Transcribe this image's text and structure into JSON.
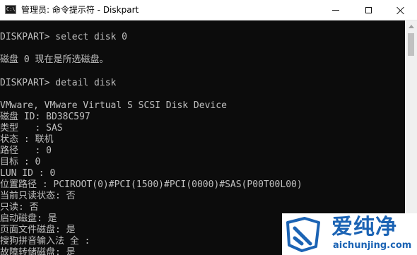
{
  "window": {
    "title": "管理员: 命令提示符 - Diskpart",
    "app_icon_text": "C:\\",
    "minimize_label": "",
    "maximize_label": "",
    "close_label": ""
  },
  "console": {
    "lines": [
      "",
      "DISKPART> select disk 0",
      "",
      "磁盘 0 现在是所选磁盘。",
      "",
      "DISKPART> detail disk",
      "",
      "VMware, VMware Virtual S SCSI Disk Device",
      "磁盘 ID: BD38C597",
      "类型   : SAS",
      "状态 : 联机",
      "路径   : 0",
      "目标 : 0",
      "LUN ID : 0",
      "位置路径 : PCIROOT(0)#PCI(1500)#PCI(0000)#SAS(P00T00L00)",
      "当前只读状态: 否",
      "只读: 否",
      "启动磁盘: 是",
      "页面文件磁盘: 是",
      "搜狗拼音输入法 全 :",
      "故障转储磁盘: 是"
    ]
  },
  "watermark": {
    "brand": "爱纯净",
    "url": "aichunjing.com",
    "color": "#1b63b4"
  }
}
